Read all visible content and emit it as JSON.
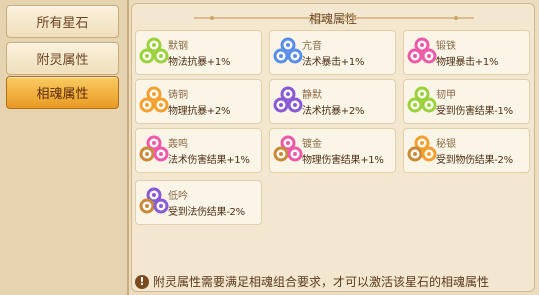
{
  "sidebar": {
    "tabs": [
      {
        "label": "所有星石"
      },
      {
        "label": "附灵属性"
      },
      {
        "label": "相魂属性",
        "active": true
      }
    ]
  },
  "panel": {
    "title": "相魂属性",
    "cards": [
      {
        "name": "默钢",
        "effect": "物法抗暴+1%",
        "gem": "green-gem-icon",
        "color": "#9bd23b"
      },
      {
        "name": "亢音",
        "effect": "法术暴击+1%",
        "gem": "blue-gem-icon",
        "color": "#5a8ee8"
      },
      {
        "name": "锻铁",
        "effect": "物理暴击+1%",
        "gem": "pink-gem-icon",
        "color": "#ef5aa8"
      },
      {
        "name": "铸铜",
        "effect": "物理抗暴+2%",
        "gem": "orange-gem-icon",
        "color": "#f5a02e"
      },
      {
        "name": "静默",
        "effect": "法术抗暴+2%",
        "gem": "purple-gem-icon",
        "color": "#8a5ad6"
      },
      {
        "name": "韧甲",
        "effect": "受到伤害结果-1%",
        "gem": "green-pink-gem-icon",
        "color": "#9bd23b"
      },
      {
        "name": "轰鸣",
        "effect": "法术伤害结果+1%",
        "gem": "pink-blue-gem-icon",
        "color": "#ef5aa8"
      },
      {
        "name": "镀金",
        "effect": "物理伤害结果+1%",
        "gem": "pink-gold-gem-icon",
        "color": "#ef5aa8"
      },
      {
        "name": "秘银",
        "effect": "受到物伤结果-2%",
        "gem": "orange-gold-gem-icon",
        "color": "#f5a02e"
      },
      {
        "name": "低吟",
        "effect": "受到法伤结果-2%",
        "gem": "purple-gold-gem-icon",
        "color": "#8a5ad6"
      }
    ]
  },
  "note": {
    "icon": "warning-icon",
    "text": "附灵属性需要满足相魂组合要求，才可以激活该星石的相魂属性"
  }
}
